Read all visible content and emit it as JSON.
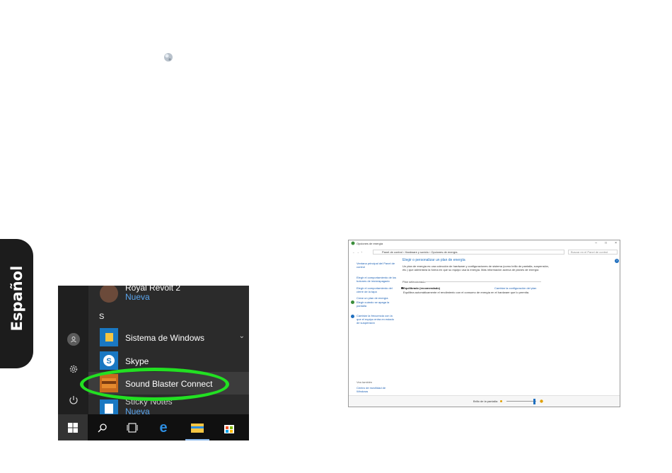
{
  "side_tab": {
    "label": "Español"
  },
  "start_menu": {
    "apps": [
      {
        "name": "Royal Revolt 2",
        "sub": "Nueva"
      },
      {
        "name": "Sistema de Windows",
        "sub": ""
      },
      {
        "name": "Skype",
        "sub": ""
      },
      {
        "name": "Sound Blaster Connect",
        "sub": ""
      },
      {
        "name": "Sticky Notes",
        "sub": "Nueva"
      }
    ],
    "section_letter": "S",
    "highlighted_app": "Sound Blaster Connect"
  },
  "control_panel": {
    "window_title": "Opciones de energía",
    "breadcrumb": "Panel de control  ›  Hardware y sonido  ›  Opciones de energía",
    "search_placeholder": "Buscar en el Panel de control",
    "left_links": [
      "Ventana principal del Panel de control",
      "Elegir el comportamiento de los botones de inicio/apagado",
      "Elegir el comportamiento del cierre de la tapa",
      "Crear un plan de energía",
      "Elegir cuándo se apaga la pantalla",
      "Cambiar la frecuencia con la que el equipo entra en estado de suspensión"
    ],
    "see_also": "Vea también",
    "see_also_links": [
      "Centro de movilidad de Windows",
      "Cuentas de usuario"
    ],
    "heading": "Elegir o personalizar un plan de energía",
    "intro": "Un plan de energía es una colección de hardware y configuraciones de sistema (como brillo de pantalla, suspensión, etc.) que administra la forma en que su equipo usa la energía. Más información acerca de planes de energía",
    "selected_label": "Plan seleccionado",
    "plan_name": "Equilibrado (recomendado)",
    "plan_desc": "Equilibra automáticamente el rendimiento con el consumo de energía en el hardware que lo permita.",
    "change_link": "Cambiar la configuración del plan",
    "brightness_label": "Brillo de la pantalla:",
    "brightness": 0.95
  },
  "colors": {
    "highlight_ring": "#22e022",
    "accent": "#1f6fbf",
    "start_bg": "#2b2b2b"
  }
}
